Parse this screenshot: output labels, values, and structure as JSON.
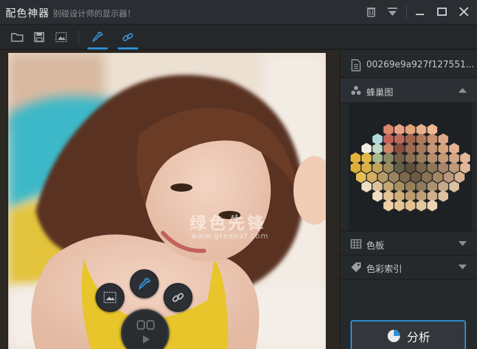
{
  "app": {
    "title": "配色神器",
    "subtitle": "别碰设计师的显示器！"
  },
  "titlebar": {
    "icons": [
      "trash-icon",
      "dropdown-icon",
      "minimize-icon",
      "maximize-icon",
      "close-icon"
    ]
  },
  "toolbar": {
    "tools": [
      "open-folder",
      "save",
      "screenshot",
      "eyedropper",
      "link"
    ]
  },
  "canvas": {
    "watermark": "绿色先锋",
    "watermark_url": "www.greenxf.com"
  },
  "side": {
    "file_name": "00269e9a927f127551...",
    "honeycomb_label": "蜂巢图",
    "palette_label": "色板",
    "color_index_label": "色彩索引",
    "analyze_label": "分析"
  },
  "honeycomb": {
    "rows": [
      [
        "#d8886e",
        "#e7a184",
        "#e5a37a",
        "#e9b08a",
        "#edb892"
      ],
      [
        "#b0d9dc",
        "#c2645c",
        "#b96a5c",
        "#a2664e",
        "#b07a5c",
        "#c89070",
        "#dba888"
      ],
      [
        "#f2ece2",
        "#bfd9c2",
        "#c8836a",
        "#8a4e3e",
        "#9e6a52",
        "#a47a5e",
        "#c59678",
        "#d8a47e",
        "#e4b290"
      ],
      [
        "#e3b43c",
        "#e2b84a",
        "#a8b890",
        "#8c8a64",
        "#74604a",
        "#8a6e52",
        "#9a7e5e",
        "#b68e6e",
        "#c29a76",
        "#d3a688",
        "#e2b89a"
      ],
      [
        "#dcae3a",
        "#d9b048",
        "#c4a45a",
        "#9a8a5c",
        "#646048",
        "#5e4e3c",
        "#7a644c",
        "#8e7658",
        "#a6866a",
        "#c0987a",
        "#e0b898"
      ],
      [
        "#e5be58",
        "#d4ae64",
        "#b49a64",
        "#9a8460",
        "#7c6a4c",
        "#6c5a44",
        "#8a7256",
        "#a48864",
        "#b9987c",
        "#d6b293"
      ],
      [
        "#ede0c2",
        "#dbc29a",
        "#c2a674",
        "#a8905e",
        "#957e5a",
        "#8e7a5e",
        "#ab9272",
        "#c4a888",
        "#dcc0a2"
      ],
      [
        "#f0dfc0",
        "#e4c496",
        "#cfac78",
        "#bc9a6e",
        "#c09e76",
        "#cfb08c",
        "#ddc2a0"
      ],
      [
        "#ecd0a4",
        "#e6c494",
        "#e2bf90",
        "#e6c89e",
        "#ecd4b2"
      ]
    ]
  }
}
